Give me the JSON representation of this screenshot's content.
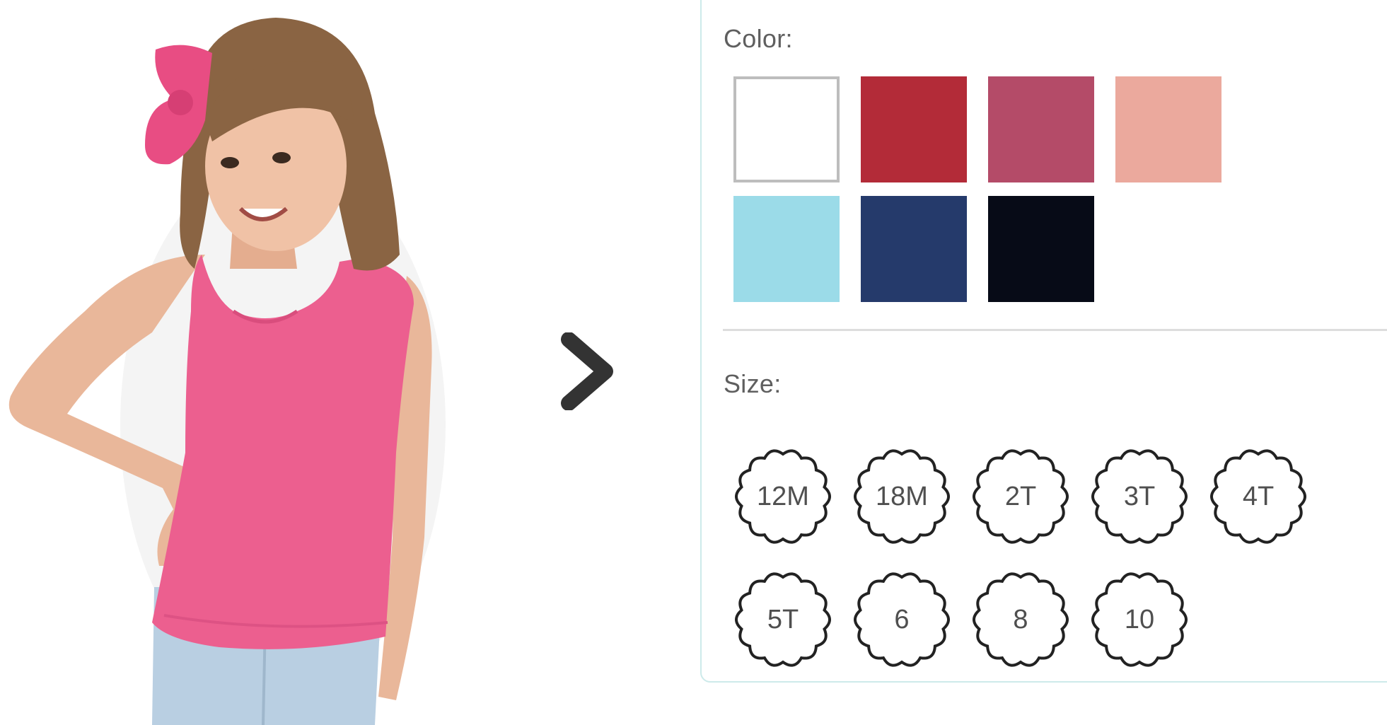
{
  "options": {
    "color_label": "Color:",
    "size_label": "Size:",
    "colors": [
      {
        "name": "white",
        "hex": "#ffffff",
        "selected": true
      },
      {
        "name": "red",
        "hex": "#b32b38",
        "selected": false
      },
      {
        "name": "raspberry",
        "hex": "#b44b68",
        "selected": false
      },
      {
        "name": "peach",
        "hex": "#eba99d",
        "selected": false
      },
      {
        "name": "light-blue",
        "hex": "#9bdbe8",
        "selected": false
      },
      {
        "name": "navy",
        "hex": "#253a6b",
        "selected": false
      },
      {
        "name": "black",
        "hex": "#070b17",
        "selected": false
      }
    ],
    "sizes": [
      "12M",
      "18M",
      "2T",
      "3T",
      "4T",
      "5T",
      "6",
      "8",
      "10"
    ]
  },
  "icons": {
    "next": "chevron-right-icon",
    "size_frame": "scalloped-circle-icon"
  },
  "theme": {
    "panel_border": "#cdeaea",
    "swatch_selected_border": "#bdbdbd",
    "tank_color": "#ec5f8f",
    "jeans_color": "#b9cfe2",
    "arrow_color": "#333333"
  }
}
